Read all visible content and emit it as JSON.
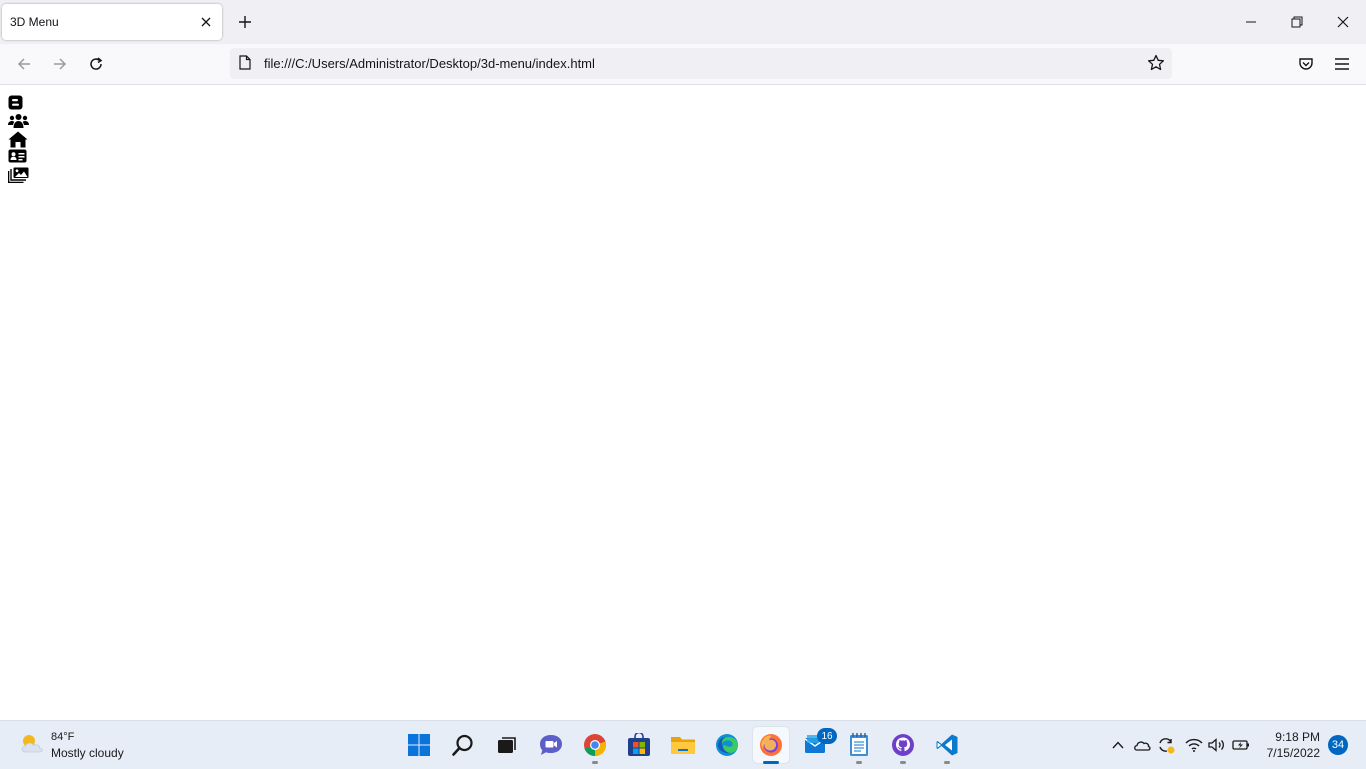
{
  "browser": {
    "tab": {
      "title": "3D Menu"
    },
    "url": "file:///C:/Users/Administrator/Desktop/3d-menu/index.html"
  },
  "page": {
    "menu_items": [
      {
        "icon": "blogger-icon"
      },
      {
        "icon": "users-icon"
      },
      {
        "icon": "home-icon"
      },
      {
        "icon": "contact-card-icon"
      },
      {
        "icon": "photo-gallery-icon"
      }
    ]
  },
  "taskbar": {
    "weather": {
      "temp": "84°F",
      "desc": "Mostly cloudy"
    },
    "apps": [
      {
        "name": "start-button",
        "icon": "windows-icon"
      },
      {
        "name": "search-button",
        "icon": "search-icon"
      },
      {
        "name": "task-view-button",
        "icon": "task-view-icon"
      },
      {
        "name": "chat-app",
        "icon": "chat-icon"
      },
      {
        "name": "chrome-app",
        "icon": "chrome-icon"
      },
      {
        "name": "store-app",
        "icon": "store-icon"
      },
      {
        "name": "file-explorer-app",
        "icon": "folder-icon"
      },
      {
        "name": "edge-app",
        "icon": "edge-icon"
      },
      {
        "name": "firefox-app",
        "icon": "firefox-icon"
      },
      {
        "name": "mail-app",
        "icon": "mail-icon",
        "badge": "16"
      },
      {
        "name": "notepad-app",
        "icon": "notepad-icon"
      },
      {
        "name": "github-desktop-app",
        "icon": "github-icon"
      },
      {
        "name": "vscode-app",
        "icon": "vscode-icon"
      }
    ],
    "clock": {
      "time": "9:18 PM",
      "date": "7/15/2022"
    },
    "notifications": "34"
  },
  "colors": {
    "accent": "#0067c0",
    "taskbar_bg": "#e6edf6",
    "chrome_bg": "#f0f0f4"
  }
}
